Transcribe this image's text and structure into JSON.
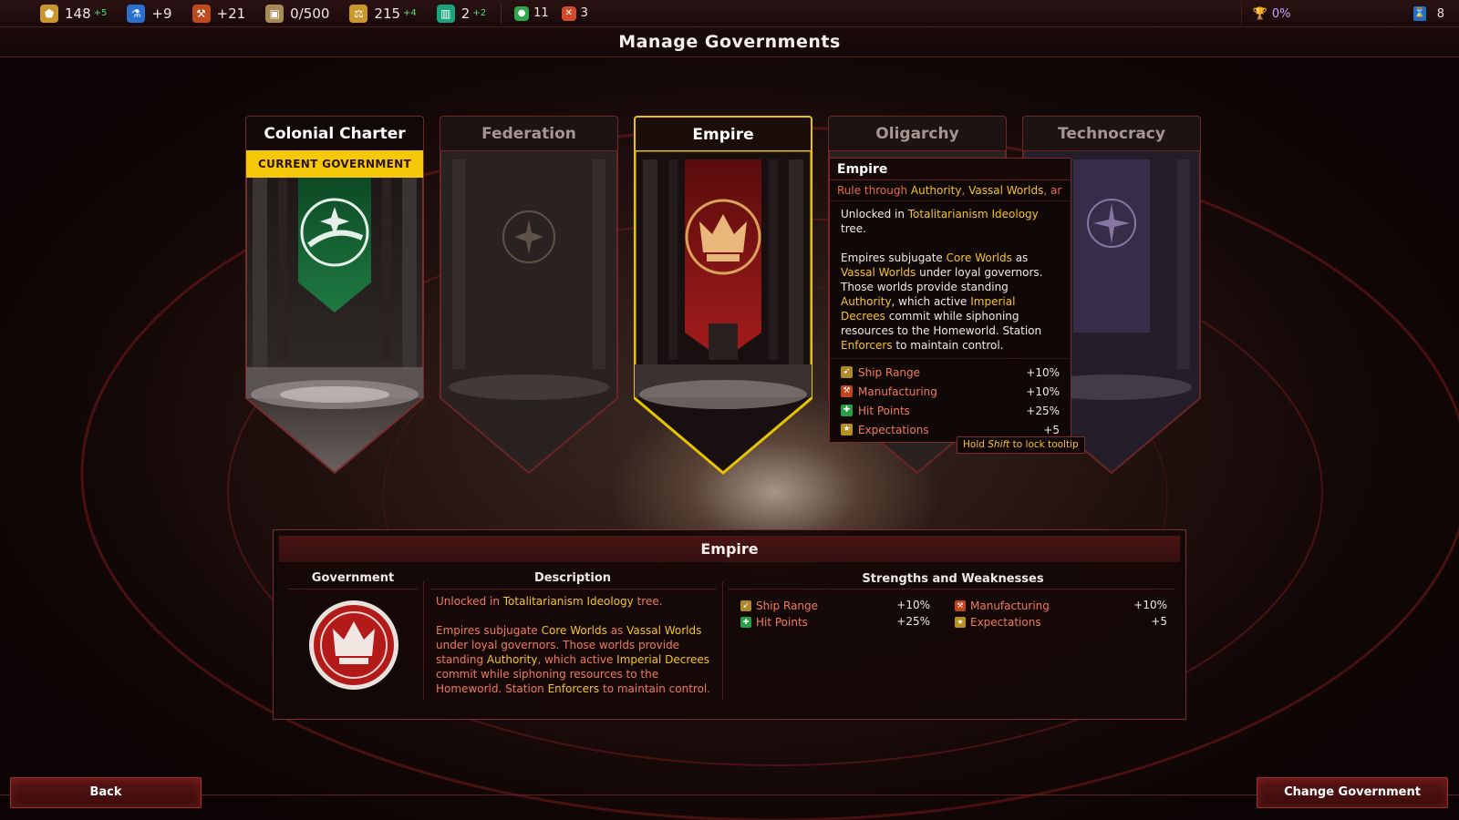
{
  "topbar": {
    "resources": [
      {
        "icon": "influence-icon",
        "value": "148",
        "delta": "+5",
        "color": "#c9972b",
        "glyph": "⬟"
      },
      {
        "icon": "science-icon",
        "value": "+9",
        "delta": "",
        "color": "#2b6fd1",
        "glyph": "⚗"
      },
      {
        "icon": "production-icon",
        "value": "+21",
        "delta": "",
        "color": "#c04a1c",
        "glyph": "⚒"
      },
      {
        "icon": "storage-icon",
        "value": "0/500",
        "delta": "",
        "color": "#a88a55",
        "glyph": "▣"
      },
      {
        "icon": "credits-icon",
        "value": "215",
        "delta": "+4",
        "color": "#c9972b",
        "glyph": "⚖"
      },
      {
        "icon": "population-icon",
        "value": "2",
        "delta": "+2",
        "color": "#1ba37c",
        "glyph": "▥"
      }
    ],
    "counters": [
      {
        "icon": "food-icon",
        "value": "11",
        "color": "#2ea84a",
        "glyph": "●"
      },
      {
        "icon": "conflict-icon",
        "value": "3",
        "color": "#d14a2b",
        "glyph": "✕"
      }
    ],
    "victory_progress": "0%",
    "turn_counter": "8"
  },
  "title": "Manage Governments",
  "governments": [
    {
      "name": "Colonial Charter",
      "state": "current",
      "current_label": "CURRENT GOVERNMENT",
      "banner_color": "#1d6b3a",
      "emblem": "globe-star-icon"
    },
    {
      "name": "Federation",
      "state": "locked",
      "banner_color": "#3a2a22",
      "emblem": "laurel-star-icon"
    },
    {
      "name": "Empire",
      "state": "selected",
      "banner_color": "#8a1414",
      "emblem": "crown-icon"
    },
    {
      "name": "Oligarchy",
      "state": "locked",
      "banner_color": "#3a2a22",
      "emblem": "pyramid-icon"
    },
    {
      "name": "Technocracy",
      "state": "locked",
      "banner_color": "#3b3250",
      "emblem": "gear-star-icon"
    }
  ],
  "tooltip": {
    "title": "Empire",
    "subtitle_parts": [
      {
        "t": "Rule through ",
        "hl": false
      },
      {
        "t": "Authority",
        "hl": true
      },
      {
        "t": ", ",
        "hl": false
      },
      {
        "t": "Vassal Worlds",
        "hl": true
      },
      {
        "t": ", ar",
        "hl": false
      }
    ],
    "unlock_parts": [
      {
        "t": "Unlocked in ",
        "hl": false
      },
      {
        "t": "Totalitarianism Ideology",
        "hl": true
      },
      {
        "t": " tree.",
        "hl": false
      }
    ],
    "description_parts": [
      {
        "t": "Empires subjugate ",
        "hl": false
      },
      {
        "t": "Core Worlds",
        "hl": true
      },
      {
        "t": " as ",
        "hl": false
      },
      {
        "t": "Vassal Worlds",
        "hl": true
      },
      {
        "t": " under loyal governors. Those worlds provide standing ",
        "hl": false
      },
      {
        "t": "Authority",
        "hl": true
      },
      {
        "t": ", which active ",
        "hl": false
      },
      {
        "t": "Imperial Decrees",
        "hl": true
      },
      {
        "t": " commit while siphoning resources to the Homeworld. Station ",
        "hl": false
      },
      {
        "t": "Enforcers",
        "hl": true
      },
      {
        "t": " to maintain control.",
        "hl": false
      }
    ],
    "stats": [
      {
        "icon": "ship-range-icon",
        "name": "Ship Range",
        "value": "+10%",
        "color": "#b08a2a",
        "glyph": "➹"
      },
      {
        "icon": "manufacturing-icon",
        "name": "Manufacturing",
        "value": "+10%",
        "color": "#c0451c",
        "glyph": "⚒"
      },
      {
        "icon": "hit-points-icon",
        "name": "Hit Points",
        "value": "+25%",
        "color": "#25a045",
        "glyph": "✚"
      },
      {
        "icon": "expectations-icon",
        "name": "Expectations",
        "value": "+5",
        "color": "#b89020",
        "glyph": "★"
      }
    ],
    "lock_hint_prefix": "Hold ",
    "lock_hint_key": "Shift",
    "lock_hint_suffix": " to lock tooltip"
  },
  "detail": {
    "title": "Empire",
    "col_government": "Government",
    "col_description": "Description",
    "col_strengths": "Strengths and Weaknesses",
    "unlock_parts": [
      {
        "t": "Unlocked in ",
        "hl": false
      },
      {
        "t": "Totalitarianism Ideology",
        "hl": true
      },
      {
        "t": " tree.",
        "hl": false
      }
    ],
    "description_parts": [
      {
        "t": "Empires subjugate ",
        "hl": false
      },
      {
        "t": "Core Worlds",
        "hl": true
      },
      {
        "t": " as ",
        "hl": false
      },
      {
        "t": "Vassal Worlds",
        "hl": true
      },
      {
        "t": " under loyal governors. Those worlds provide standing ",
        "hl": false
      },
      {
        "t": "Authority",
        "hl": true
      },
      {
        "t": ", which active ",
        "hl": false
      },
      {
        "t": "Imperial Decrees",
        "hl": true
      },
      {
        "t": " commit while siphoning resources to the Homeworld. Station ",
        "hl": false
      },
      {
        "t": "Enforcers",
        "hl": true
      },
      {
        "t": " to maintain control.",
        "hl": false
      }
    ],
    "stats": [
      {
        "name": "Ship Range",
        "value": "+10%"
      },
      {
        "name": "Manufacturing",
        "value": "+10%"
      },
      {
        "name": "Hit Points",
        "value": "+25%"
      },
      {
        "name": "Expectations",
        "value": "+5"
      }
    ]
  },
  "buttons": {
    "back": "Back",
    "change": "Change Government"
  },
  "colors": {
    "highlight": "#f5c425",
    "accent_red": "#ef7b5c",
    "selected_border": "#e6c400"
  }
}
